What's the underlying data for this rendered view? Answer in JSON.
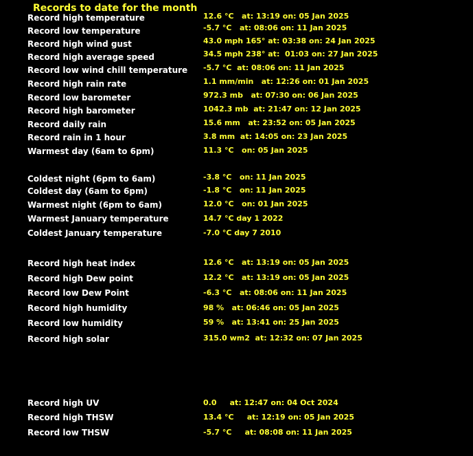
{
  "title": "Records to date for the month",
  "colors": {
    "background": "#000000",
    "label": "#ffffff",
    "value": "#ffff33"
  },
  "records": [
    {
      "label": "Record high temperature",
      "value": "12.6 °C   at: 13:19 on: 05 Jan 2025"
    },
    {
      "label": "Record low temperature",
      "value": "-5.7 °C   at: 08:06 on: 11 Jan 2025"
    },
    {
      "label": "Record high wind gust",
      "value": "43.0 mph 165° at: 03:38 on: 24 Jan 2025"
    },
    {
      "label": "Record high average speed",
      "value": "34.5 mph 238° at:  01:03 on: 27 Jan 2025"
    },
    {
      "label": "Record low wind chill temperature",
      "value": "-5.7 °C  at: 08:06 on: 11 Jan 2025"
    },
    {
      "label": "Record high rain rate",
      "value": "1.1 mm/min   at: 12:26 on: 01 Jan 2025"
    },
    {
      "label": "Record low barometer",
      "value": "972.3 mb   at: 07:30 on: 06 Jan 2025"
    },
    {
      "label": "Record high barometer",
      "value": "1042.3 mb  at: 21:47 on: 12 Jan 2025"
    },
    {
      "label": "Record daily rain",
      "value": "15.6 mm   at: 23:52 on: 05 Jan 2025"
    },
    {
      "label": "Record rain in 1 hour",
      "value": "3.8 mm  at: 14:05 on: 23 Jan 2025"
    },
    {
      "label": "Warmest day (6am to 6pm)",
      "value": "11.3 °C   on: 05 Jan 2025"
    },
    {
      "label": "Coldest night (6pm to 6am)",
      "value": "-3.8 °C   on: 11 Jan 2025"
    },
    {
      "label": "Coldest day (6am to 6pm)",
      "value": "-1.8 °C   on: 11 Jan 2025"
    },
    {
      "label": "Warmest night (6pm to 6am)",
      "value": "12.0 °C   on: 01 Jan 2025"
    },
    {
      "label": "Warmest January temperature",
      "value": "14.7 °C day 1 2022"
    },
    {
      "label": "Coldest January temperature",
      "value": "-7.0 °C day 7 2010"
    },
    {
      "label": "Record high heat index",
      "value": "12.6 °C   at: 13:19 on: 05 Jan 2025"
    },
    {
      "label": "Record high Dew point",
      "value": "12.2 °C   at: 13:19 on: 05 Jan 2025"
    },
    {
      "label": "Record low Dew Point",
      "value": "-6.3 °C   at: 08:06 on: 11 Jan 2025"
    },
    {
      "label": "Record high humidity",
      "value": "98 %   at: 06:46 on: 05 Jan 2025"
    },
    {
      "label": "Record low humidity",
      "value": "59 %   at: 13:41 on: 25 Jan 2025"
    },
    {
      "label": "Record high solar",
      "value": "315.0 wm2  at: 12:32 on: 07 Jan 2025"
    },
    {
      "label": "Record high UV",
      "value": "0.0     at: 12:47 on: 04 Oct 2024"
    },
    {
      "label": "Record high THSW",
      "value": "13.4 °C     at: 12:19 on: 05 Jan 2025"
    },
    {
      "label": "Record low THSW",
      "value": "-5.7 °C     at: 08:08 on: 11 Jan 2025"
    }
  ]
}
